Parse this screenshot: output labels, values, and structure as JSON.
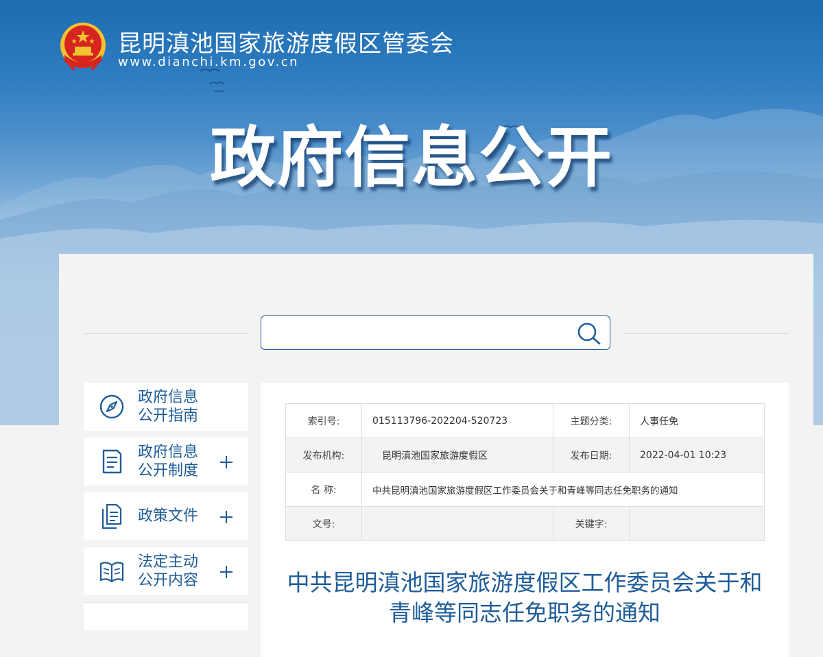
{
  "header": {
    "site_name": "昆明滇池国家旅游度假区管委会",
    "site_url": "www.dianchi.km.gov.cn",
    "emblem_icon": "national-emblem-icon",
    "hero_title": "政府信息公开"
  },
  "search": {
    "value": "",
    "placeholder": "",
    "icon": "search-icon"
  },
  "sidebar": {
    "items": [
      {
        "label_line1": "政府信息",
        "label_line2": "公开指南",
        "icon": "compass-icon",
        "expandable": false
      },
      {
        "label_line1": "政府信息",
        "label_line2": "公开制度",
        "icon": "document-list-icon",
        "expandable": true
      },
      {
        "label_line1": "政策文件",
        "label_line2": "",
        "icon": "files-icon",
        "expandable": true
      },
      {
        "label_line1": "法定主动",
        "label_line2": "公开内容",
        "icon": "open-book-icon",
        "expandable": true
      }
    ]
  },
  "metadata": {
    "index_label": "索引号:",
    "index_value": "015113796-202204-520723",
    "topic_label": "主题分类:",
    "topic_value": "人事任免",
    "publisher_label": "发布机构:",
    "publisher_value": "昆明滇池国家旅游度假区",
    "date_label": "发布日期:",
    "date_value": "2022-04-01 10:23",
    "name_label": "名 称:",
    "name_value": "中共昆明滇池国家旅游度假区工作委员会关于和青峰等同志任免职务的通知",
    "docno_label": "文号:",
    "docno_value": "",
    "keyword_label": "关键字:",
    "keyword_value": ""
  },
  "article": {
    "title": "中共昆明滇池国家旅游度假区工作委员会关于和青峰等同志任免职务的通知"
  },
  "colors": {
    "primary_blue": "#1e5c98",
    "banner_top": "#1d6cb1",
    "panel_bg": "#f3f3f3",
    "emblem_red": "#d6241f",
    "emblem_gold": "#f2c230"
  }
}
